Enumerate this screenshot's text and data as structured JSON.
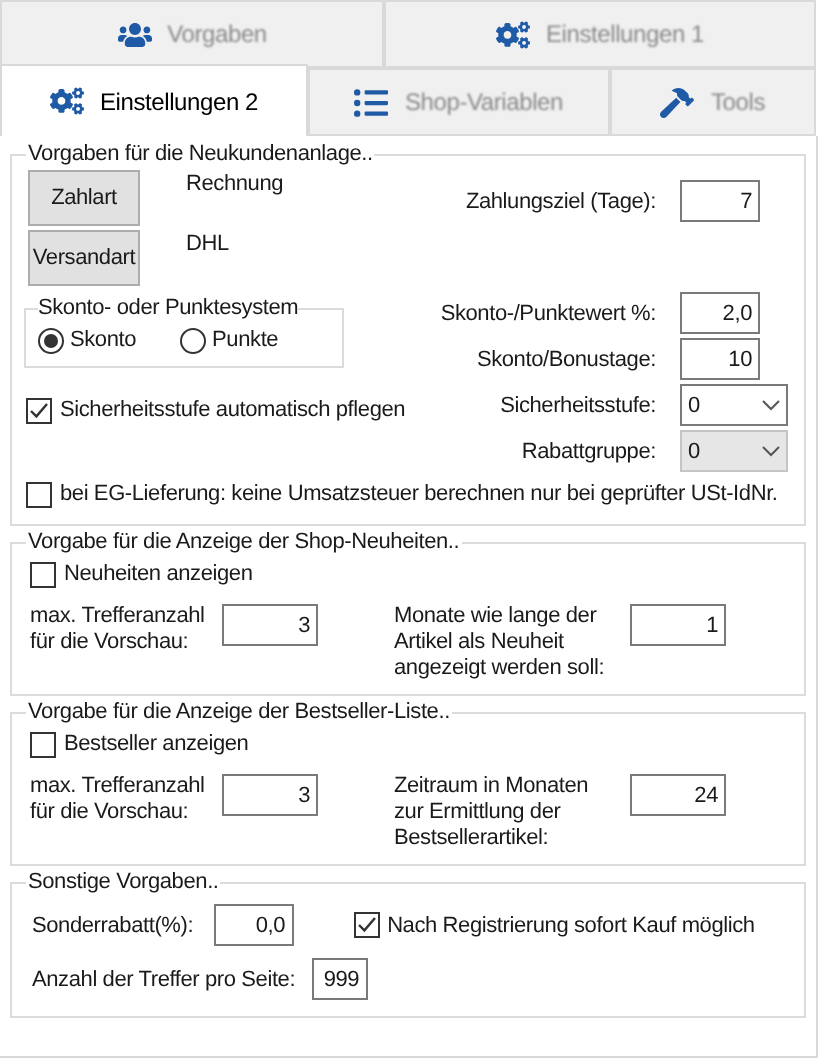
{
  "tab_rows": [
    [
      {
        "label": "Vorgaben",
        "selected": false
      },
      {
        "label": "Einstellungen 1",
        "selected": false
      }
    ],
    [
      {
        "label": "Einstellungen 2",
        "selected": true
      },
      {
        "label": "Shop-Variablen",
        "selected": false
      },
      {
        "label": "Tools",
        "selected": false
      }
    ]
  ],
  "new_customer": {
    "title": "Vorgaben für die Neukundenanlage..",
    "payment_button": "Zahlart",
    "payment_value": "Rechnung",
    "shipping_button": "Versandart",
    "shipping_value": "DHL",
    "payment_term": {
      "label": "Zahlungsziel (Tage):",
      "value": "7"
    },
    "discount_system": {
      "title": "Skonto- oder Punktesystem",
      "options": [
        {
          "label": "Skonto",
          "selected": true
        },
        {
          "label": "Punkte",
          "selected": false
        }
      ]
    },
    "discount_value": {
      "label": "Skonto-/Punktewert %:",
      "value": "2,0"
    },
    "discount_days": {
      "label": "Skonto/Bonustage:",
      "value": "10"
    },
    "security_level": {
      "label": "Sicherheitsstufe:",
      "value": "0",
      "disabled": false
    },
    "rebate_group": {
      "label": "Rabattgruppe:",
      "value": "0",
      "disabled": true
    },
    "auto_security": {
      "label": "Sicherheitsstufe automatisch pflegen",
      "checked": true
    },
    "eu_delivery": {
      "label": "bei EG-Lieferung: keine Umsatzsteuer berechnen nur bei geprüfter USt-IdNr.",
      "checked": false
    }
  },
  "new_items": {
    "title": "Vorgabe für die Anzeige der Shop-Neuheiten..",
    "show": {
      "label": "Neuheiten anzeigen",
      "checked": false
    },
    "max_hits": {
      "label": "max. Trefferanzahl für die Vorschau:",
      "value": "3"
    },
    "second": {
      "label": "Monate wie lange der Artikel als Neuheit angezeigt werden soll:",
      "value": "1"
    }
  },
  "bestsellers": {
    "title": "Vorgabe für die Anzeige der Bestseller-Liste..",
    "show": {
      "label": "Bestseller anzeigen",
      "checked": false
    },
    "max_hits": {
      "label": "max. Trefferanzahl für die Vorschau:",
      "value": "3"
    },
    "second": {
      "label": "Zeitraum in Monaten zur Ermittlung der Bestsellerartikel:",
      "value": "24"
    }
  },
  "misc": {
    "title": "Sonstige Vorgaben..",
    "special_discount": {
      "label": "Sonderrabatt(%):",
      "value": "0,0"
    },
    "instant_purchase": {
      "label": "Nach Registrierung sofort Kauf möglich",
      "checked": true
    },
    "hits_per_page": {
      "label": "Anzahl der Treffer pro Seite:",
      "value": "999"
    }
  }
}
